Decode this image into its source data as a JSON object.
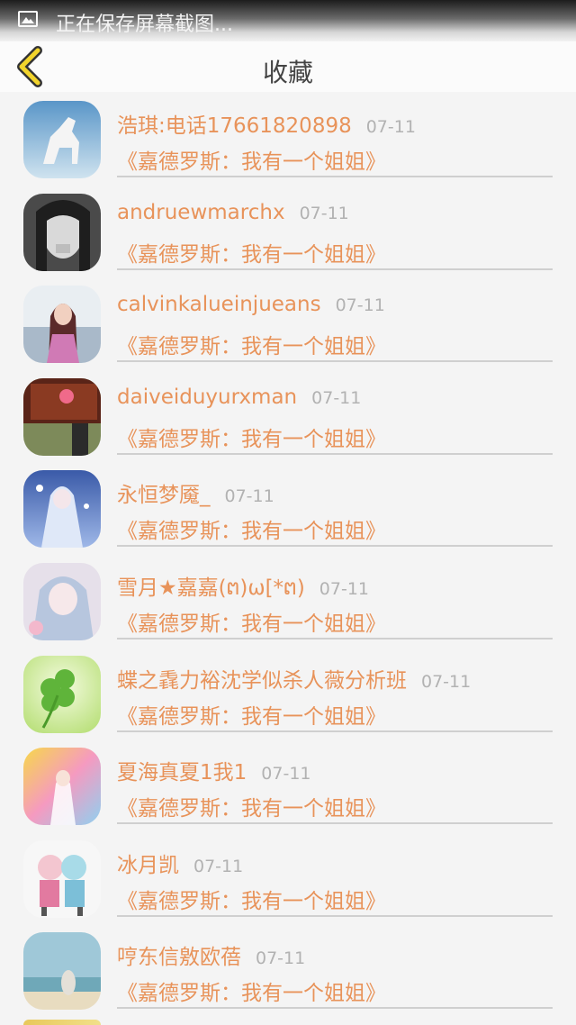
{
  "status_bar": {
    "icon": "image-icon",
    "text": "正在保存屏幕截图..."
  },
  "header": {
    "back_icon": "chevron-left-icon",
    "title": "收藏",
    "accent_color": "#f2d42c"
  },
  "colors": {
    "accent_text": "#e8935a",
    "date_text": "#b2b2b2",
    "background": "#f4f4f4"
  },
  "favorites": [
    {
      "name": "浩琪:电话17661820898",
      "date": "07-11",
      "title": "《嘉德罗斯：我有一个姐姐》",
      "avatar": "white-horse-avatar"
    },
    {
      "name": "andruewmarchx",
      "date": "07-11",
      "title": "《嘉德罗斯：我有一个姐姐》",
      "avatar": "bw-girl-avatar"
    },
    {
      "name": "calvinkalueinjueans",
      "date": "07-11",
      "title": "《嘉德罗斯：我有一个姐姐》",
      "avatar": "girl-pink-avatar"
    },
    {
      "name": "daiveiduyurxman",
      "date": "07-11",
      "title": "《嘉德罗斯：我有一个姐姐》",
      "avatar": "red-bag-avatar"
    },
    {
      "name": "永恒梦魇_",
      "date": "07-11",
      "title": "《嘉德罗斯：我有一个姐姐》",
      "avatar": "anime-blue-avatar"
    },
    {
      "name": "雪月★嘉嘉(ຕ)ω[*ຕ)",
      "date": "07-11",
      "title": "《嘉德罗斯：我有一个姐姐》",
      "avatar": "anime-pastel-avatar"
    },
    {
      "name": "蝶之毳力裕沈学似杀人薇分析班",
      "date": "07-11",
      "title": "《嘉德罗斯：我有一个姐姐》",
      "avatar": "clover-avatar"
    },
    {
      "name": "夏海真夏1我1",
      "date": "07-11",
      "title": "《嘉德罗斯：我有一个姐姐》",
      "avatar": "rainbow-anime-avatar"
    },
    {
      "name": "冰月凯",
      "date": "07-11",
      "title": "《嘉德罗斯：我有一个姐姐》",
      "avatar": "chibi-pair-avatar"
    },
    {
      "name": "哼东信敫欧蓓",
      "date": "07-11",
      "title": "《嘉德罗斯：我有一个姐姐》",
      "avatar": "beach-avatar"
    }
  ]
}
